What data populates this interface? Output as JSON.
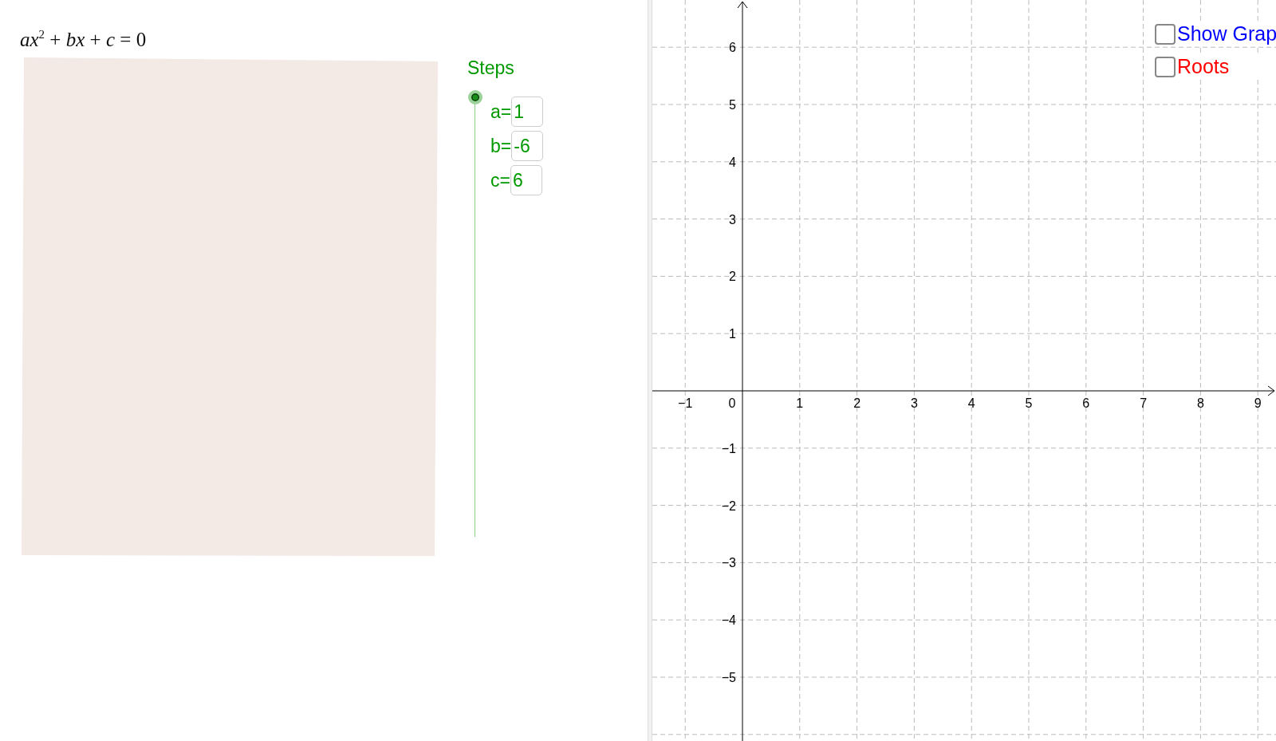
{
  "equation": "*ax*$^{2}$ + *bx* + *c* = 0",
  "steps_slider": {
    "label": "Steps",
    "level": 1
  },
  "coefficients": [
    {
      "label": "a=",
      "value": "1"
    },
    {
      "label": "b=",
      "value": "-6"
    },
    {
      "label": "c=",
      "value": "6"
    }
  ],
  "graph": {
    "x_labels": [
      "−1",
      "1",
      "2",
      "3",
      "4",
      "5",
      "6",
      "7",
      "8",
      "9"
    ],
    "origin_label": "0",
    "y_labels": [
      "6",
      "5",
      "4",
      "3",
      "2",
      "1",
      "−1",
      "−2",
      "−3",
      "−4",
      "−5"
    ],
    "checkboxes": [
      {
        "label": "Show Grap",
        "checked": false,
        "color": "#0000ff"
      },
      {
        "label": "Roots",
        "checked": false,
        "color": "#ff0000"
      }
    ]
  }
}
